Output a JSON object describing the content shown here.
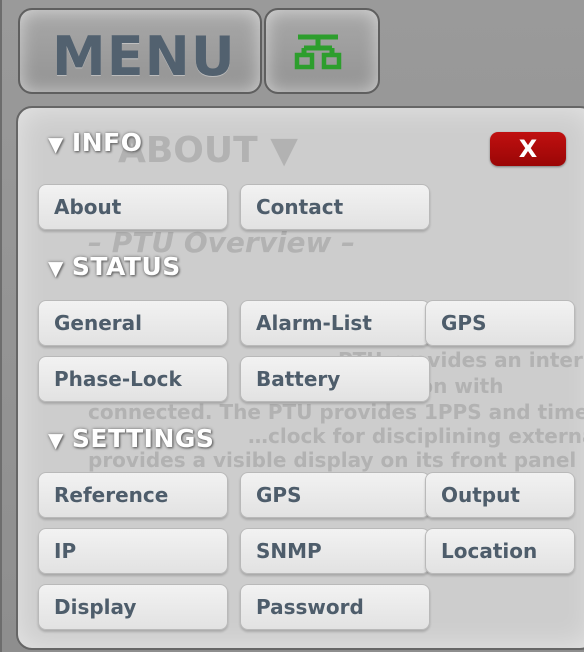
{
  "header": {
    "menu_label": "MENU",
    "network_icon": "network-topology-icon",
    "network_icon_color": "#2d9e2d"
  },
  "panel": {
    "close_label": "X",
    "close_color": "#b00a0a",
    "background_text": {
      "title": "ABOUT ▼",
      "subtitle": "– PTU Overview –",
      "lines": [
        "…PTU provides an internal",
        "…operation with",
        "connected. The PTU provides 1PPS and time",
        "…clock for disciplining external",
        "provides a visible display on its front panel"
      ]
    },
    "sections": {
      "info": {
        "label": "INFO",
        "buttons": [
          "About",
          "Contact"
        ]
      },
      "status": {
        "label": "STATUS",
        "buttons": [
          "General",
          "Alarm-List",
          "GPS",
          "Phase-Lock",
          "Battery"
        ]
      },
      "settings": {
        "label": "SETTINGS",
        "buttons": [
          "Reference",
          "GPS",
          "Output",
          "IP",
          "SNMP",
          "Location",
          "Display",
          "Password"
        ]
      }
    }
  }
}
